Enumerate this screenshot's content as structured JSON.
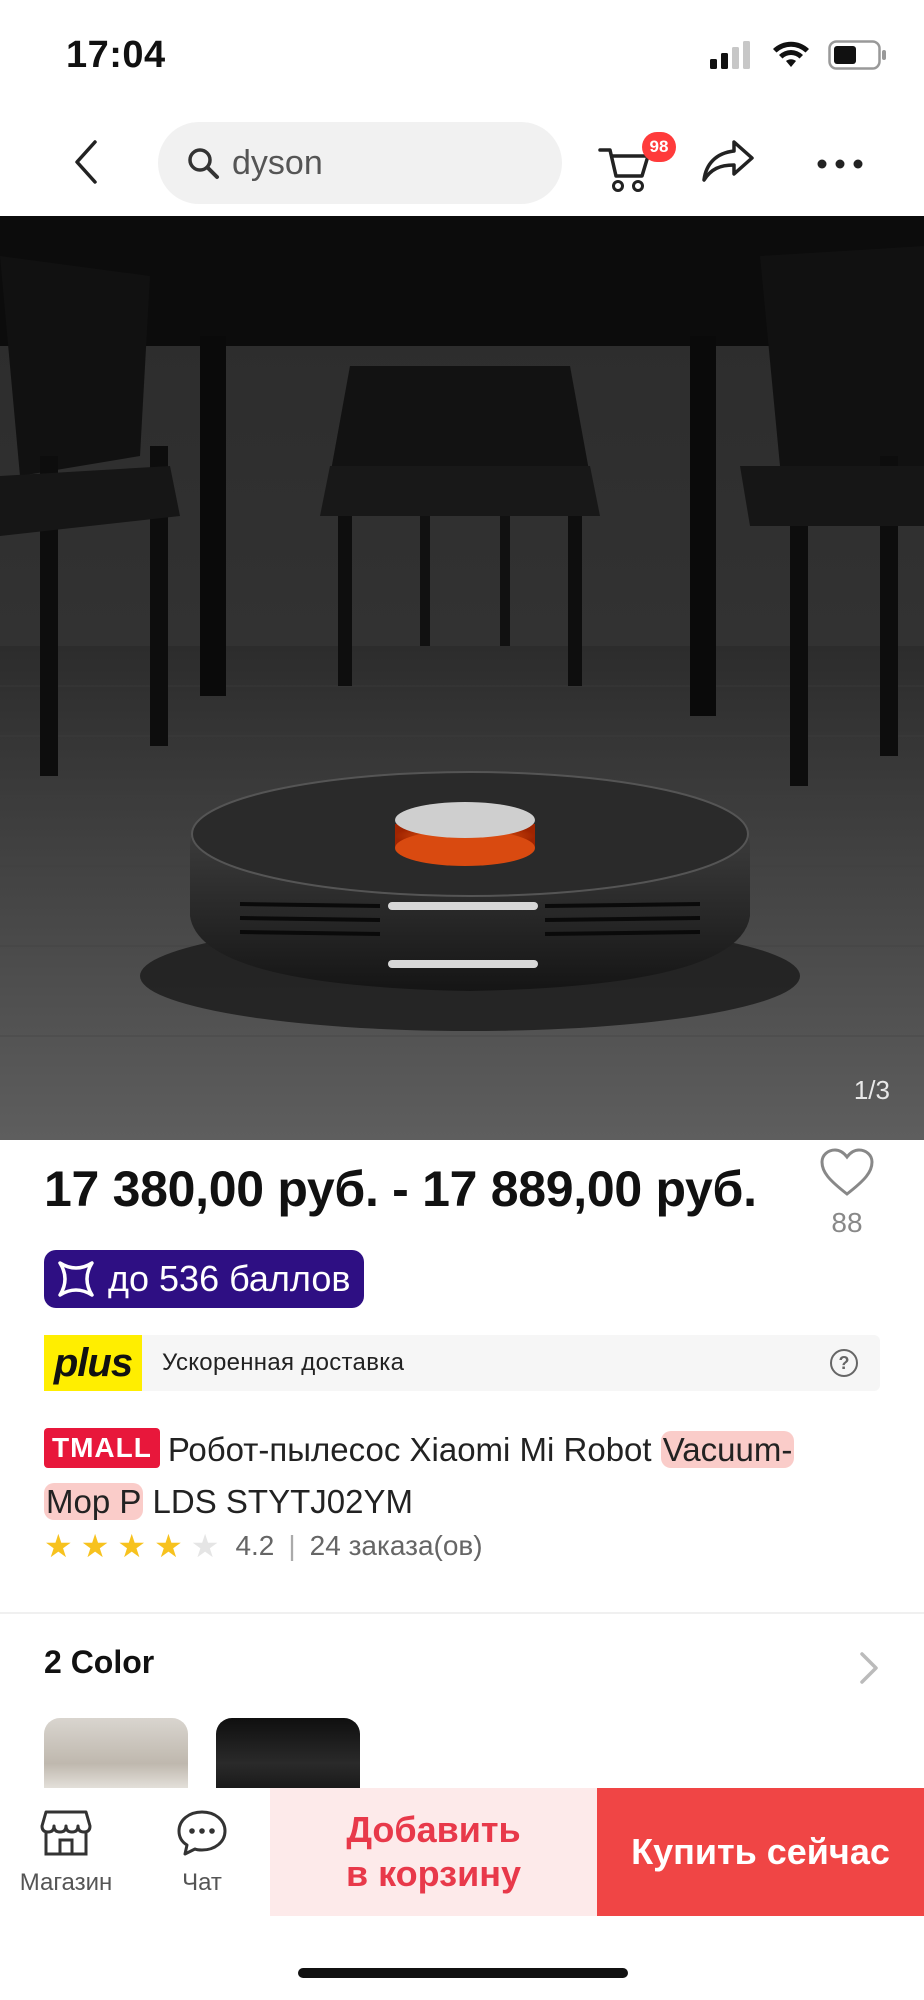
{
  "status_bar": {
    "time": "17:04"
  },
  "search": {
    "query": "dyson"
  },
  "cart": {
    "badge": "98"
  },
  "gallery": {
    "counter": "1/3"
  },
  "product": {
    "price": "17 380,00 руб. - 17 889,00 руб.",
    "wishlist_count": "88",
    "points": "до 536 баллов",
    "plus_logo": "plus",
    "delivery": "Ускоренная доставка",
    "tmall": "TMALL",
    "title_part1": "Робот-пылесос Xiaomi Mi Robot ",
    "title_hl1": "Vacuum-",
    "title_hl2": "Mop P",
    "title_part2": " LDS STYTJ02YM",
    "rating": "4.2",
    "rating_stars": 4.2,
    "rating_sep": "|",
    "orders": "24 заказа(ов)"
  },
  "colors": {
    "label": "2 Color"
  },
  "bottom_bar": {
    "shop_label": "Магазин",
    "chat_label": "Чат",
    "add_to_cart_line1": "Добавить",
    "add_to_cart_line2": "в корзину",
    "buy_now": "Купить сейчас"
  }
}
